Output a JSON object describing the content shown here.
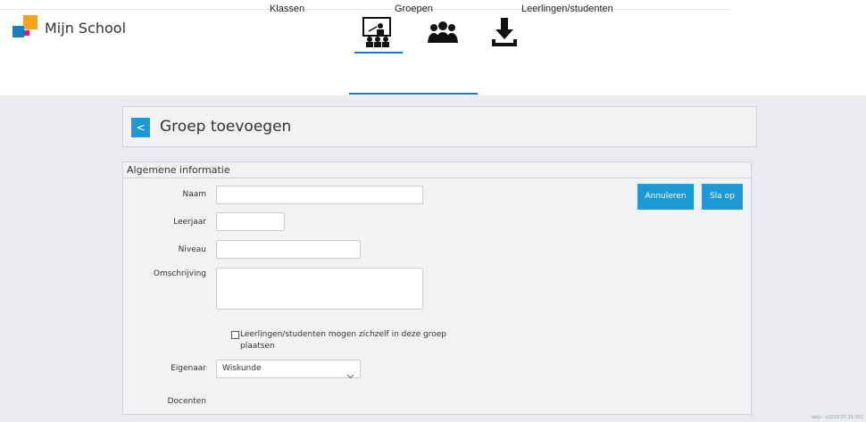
{
  "app": {
    "title": "Mijn School"
  },
  "header_icons": [
    {
      "name": "klassen-teacher-icon"
    },
    {
      "name": "groepen-people-icon"
    },
    {
      "name": "download-icon"
    }
  ],
  "tabs": [
    {
      "label": "Klassen"
    },
    {
      "label": "Groepen",
      "active": true
    },
    {
      "label": "Leerlingen/studenten"
    }
  ],
  "page": {
    "back_label": "<",
    "title": "Groep toevoegen"
  },
  "form": {
    "section_title": "Algemene informatie",
    "labels": {
      "naam": "Naam",
      "leerjaar": "Leerjaar",
      "niveau": "Niveau",
      "omschrijving": "Omschrijving",
      "eigenaar": "Eigenaar",
      "docenten": "Docenten"
    },
    "values": {
      "naam": "",
      "leerjaar": "",
      "niveau": "",
      "omschrijving": ""
    },
    "checkbox": {
      "label": "Leerlingen/studenten mogen zichzelf in deze groep plaatsen",
      "checked": false
    },
    "eigenaar_selected": "Wiskunde",
    "buttons": {
      "cancel": "Annuleren",
      "save": "Sla op"
    }
  },
  "footer": {
    "note": "web - v2019.07.26.002"
  },
  "colors": {
    "accent": "#1d9ad6",
    "logo_orange": "#f7a21b",
    "logo_blue": "#1a7cc1",
    "logo_pink": "#e5166a"
  }
}
